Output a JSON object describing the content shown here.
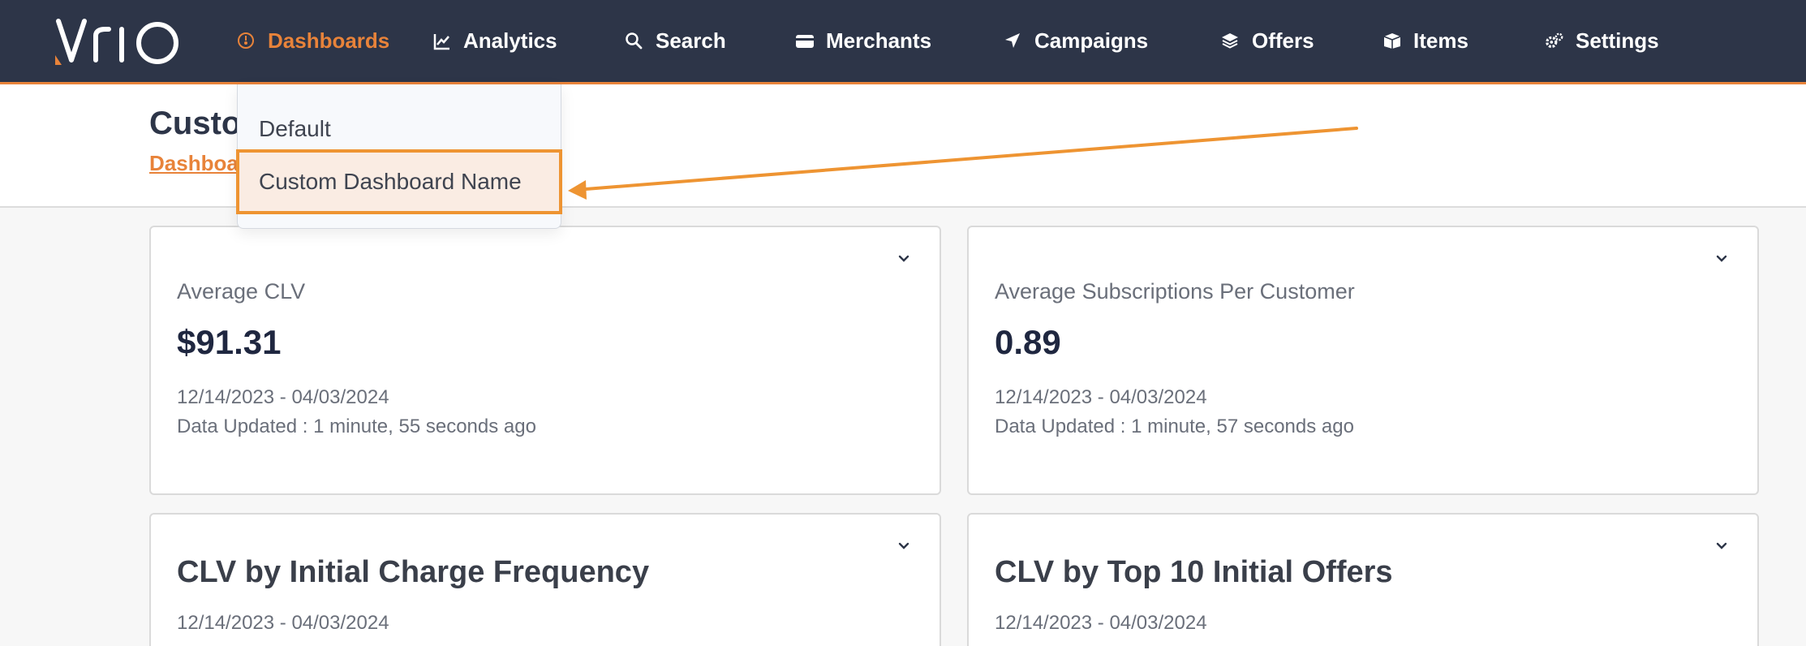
{
  "brand": {
    "logo_text": "vrio",
    "accent": "#e8833a",
    "nav_bg": "#2d3548"
  },
  "nav": {
    "dashboards": {
      "label": "Dashboards",
      "icon": "dashboard-gauge-icon"
    },
    "analytics": {
      "label": "Analytics",
      "icon": "line-chart-icon"
    },
    "search": {
      "label": "Search",
      "icon": "search-icon"
    },
    "merchants": {
      "label": "Merchants",
      "icon": "credit-card-icon"
    },
    "campaigns": {
      "label": "Campaigns",
      "icon": "location-arrow-icon"
    },
    "offers": {
      "label": "Offers",
      "icon": "layers-icon"
    },
    "items": {
      "label": "Items",
      "icon": "box-icon"
    },
    "settings": {
      "label": "Settings",
      "icon": "gears-icon"
    }
  },
  "header": {
    "title": "Custo",
    "breadcrumb": "Dashboa"
  },
  "dropdown": {
    "items": [
      {
        "label": "Default"
      },
      {
        "label": "Custom Dashboard Name"
      }
    ],
    "highlight_color": "#ee9432"
  },
  "cards": [
    {
      "label": "Average CLV",
      "value": "$91.31",
      "date_range": "12/14/2023 - 04/03/2024",
      "updated": "Data Updated : 1 minute, 55 seconds ago"
    },
    {
      "label": "Average Subscriptions Per Customer",
      "value": "0.89",
      "date_range": "12/14/2023 - 04/03/2024",
      "updated": "Data Updated : 1 minute, 57 seconds ago"
    },
    {
      "title": "CLV by Initial Charge Frequency",
      "date_range": "12/14/2023 - 04/03/2024"
    },
    {
      "title": "CLV by Top 10 Initial Offers",
      "date_range": "12/14/2023 - 04/03/2024"
    }
  ]
}
